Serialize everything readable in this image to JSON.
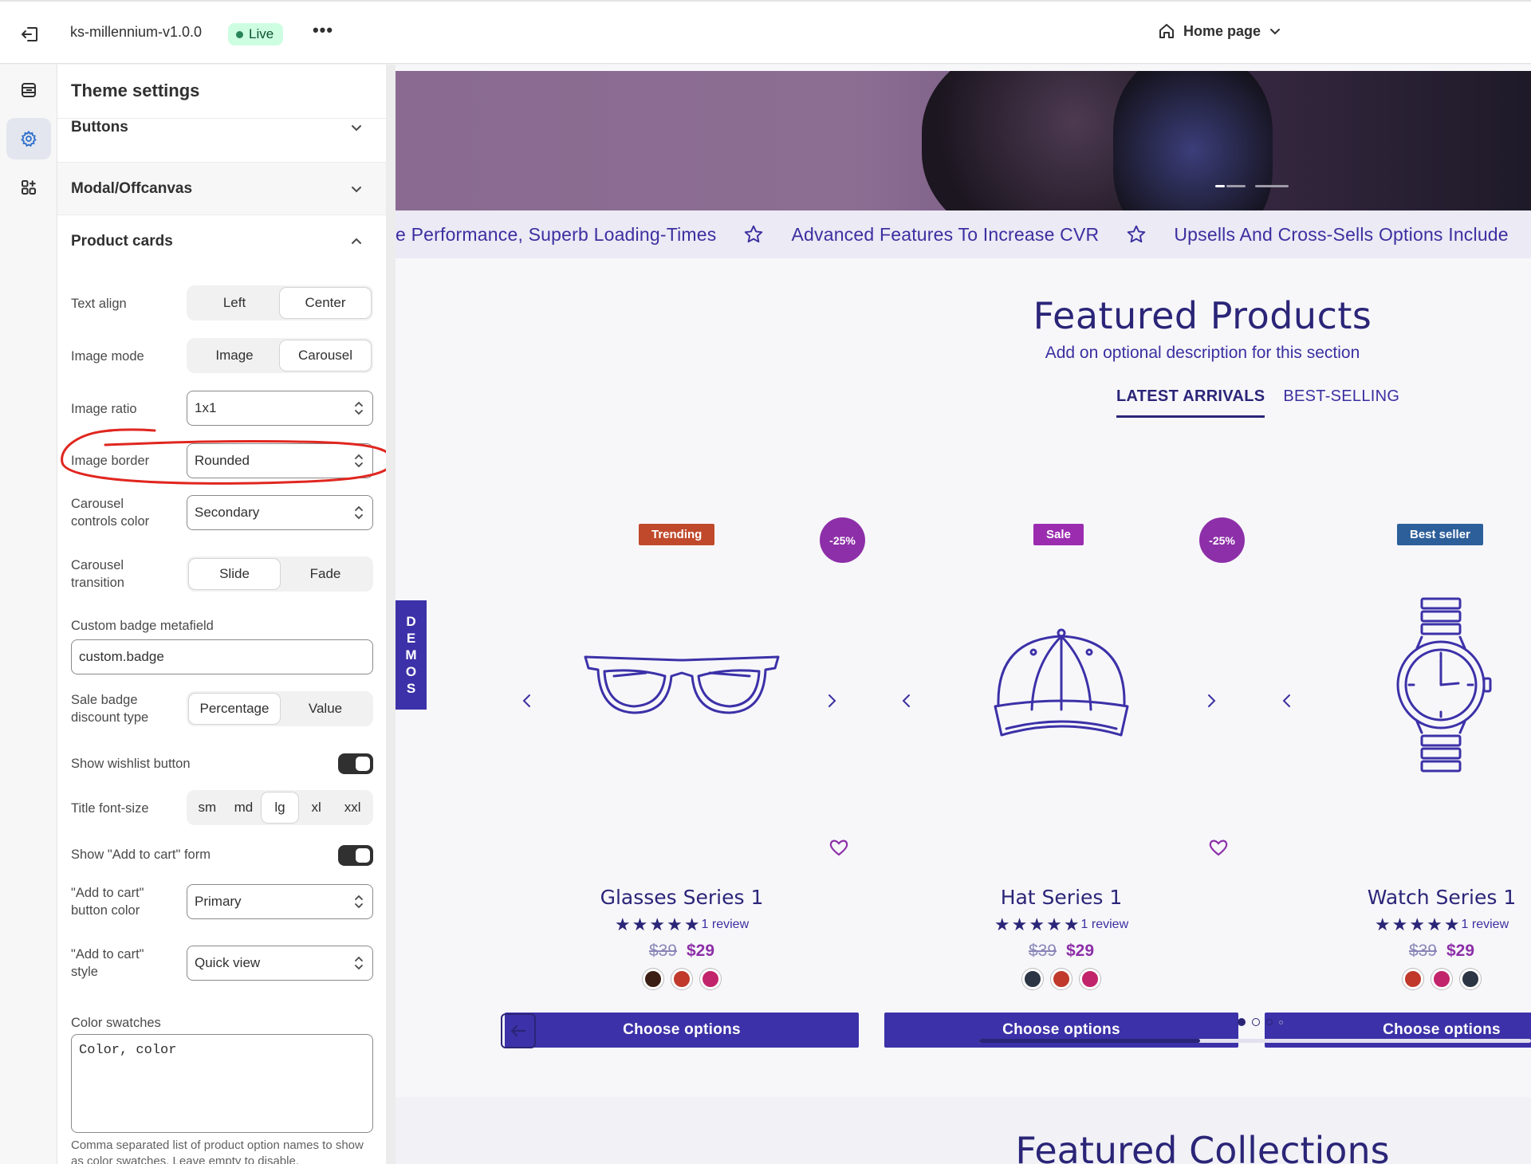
{
  "topbar": {
    "theme_name": "ks-millennium-v1.0.0",
    "status": "Live",
    "more": "•••",
    "page_selector": "Home page"
  },
  "panel": {
    "title": "Theme settings",
    "sections": {
      "buttons": "Buttons",
      "modal": "Modal/Offcanvas",
      "product_cards": "Product cards"
    },
    "text_align": {
      "label": "Text align",
      "options": [
        "Left",
        "Center"
      ],
      "selected": "Center"
    },
    "image_mode": {
      "label": "Image mode",
      "options": [
        "Image",
        "Carousel"
      ],
      "selected": "Carousel"
    },
    "image_ratio": {
      "label": "Image ratio",
      "value": "1x1"
    },
    "image_border": {
      "label": "Image border",
      "value": "Rounded"
    },
    "carousel_controls_color": {
      "label": "Carousel controls color",
      "value": "Secondary"
    },
    "carousel_transition": {
      "label": "Carousel transition",
      "options": [
        "Slide",
        "Fade"
      ],
      "selected": "Slide"
    },
    "custom_badge": {
      "label": "Custom badge metafield",
      "value": "custom.badge"
    },
    "sale_badge": {
      "label": "Sale badge discount type",
      "options": [
        "Percentage",
        "Value"
      ],
      "selected": "Percentage"
    },
    "show_wishlist": {
      "label": "Show wishlist button",
      "on": true
    },
    "title_font_size": {
      "label": "Title font-size",
      "options": [
        "sm",
        "md",
        "lg",
        "xl",
        "xxl"
      ],
      "selected": "lg"
    },
    "show_add_to_cart": {
      "label": "Show \"Add to cart\" form",
      "on": true
    },
    "add_to_cart_color": {
      "label": "\"Add to cart\" button color",
      "value": "Primary"
    },
    "add_to_cart_style": {
      "label": "\"Add to cart\" style",
      "value": "Quick view"
    },
    "color_swatches": {
      "label": "Color swatches",
      "value": "Color, color",
      "help": "Comma separated list of product option names to show as color swatches. Leave empty to disable."
    }
  },
  "preview": {
    "marquee": [
      "e Performance, Superb Loading-Times",
      "Advanced Features To Increase CVR",
      "Upsells And Cross-Sells Options Include"
    ],
    "section_title": "Featured Products",
    "section_desc": "Add on optional description for this section",
    "tabs": [
      "LATEST ARRIVALS",
      "BEST-SELLING"
    ],
    "active_tab": "LATEST ARRIVALS",
    "demos": [
      "D",
      "E",
      "M",
      "O",
      "S"
    ],
    "products": [
      {
        "name": "Glasses Series 1",
        "badge": "Trending",
        "badge_color": "#c0492b",
        "discount": "-25%",
        "reviews": "1 review",
        "rating": 5,
        "old_price": "$39",
        "price": "$29",
        "swatches": [
          "#3b1f14",
          "#c0392b",
          "#c2246b"
        ],
        "button": "Choose options",
        "icon": "glasses-icon"
      },
      {
        "name": "Hat Series 1",
        "badge": "Sale",
        "badge_color": "#9b2cb0",
        "discount": "-25%",
        "reviews": "1 review",
        "rating": 5,
        "old_price": "$39",
        "price": "$29",
        "swatches": [
          "#2c3544",
          "#c0392b",
          "#c2246b"
        ],
        "button": "Choose options",
        "icon": "cap-icon"
      },
      {
        "name": "Watch Series 1",
        "badge": "Best seller",
        "badge_color": "#2d5f9a",
        "discount": "",
        "reviews": "1 review",
        "rating": 5,
        "old_price": "$39",
        "price": "$29",
        "swatches": [
          "#c0392b",
          "#c2246b",
          "#2c3544"
        ],
        "button": "Choose options",
        "icon": "watch-icon"
      }
    ],
    "carousel_progress": 0.4,
    "next_section_title": "Featured Collections",
    "colors": {
      "primary": "#3c31a8",
      "heading": "#2b2578",
      "accent": "#8d2fa8"
    }
  }
}
